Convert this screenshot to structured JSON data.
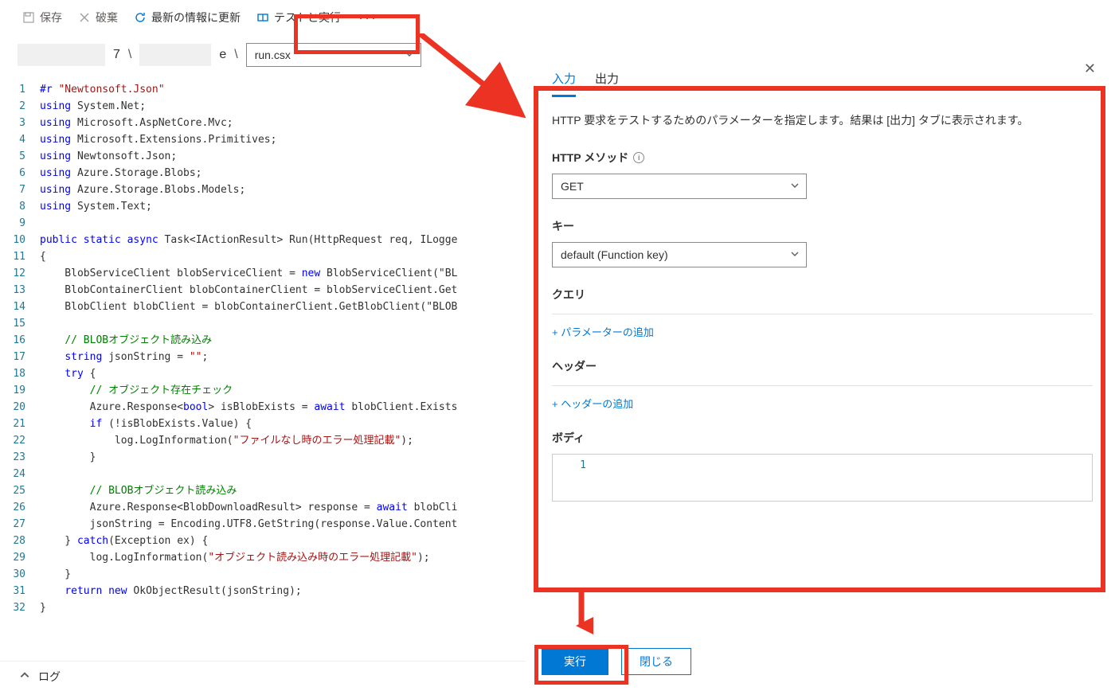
{
  "toolbar": {
    "save": "保存",
    "discard": "破棄",
    "refresh": "最新の情報に更新",
    "test_run": "テストと実行"
  },
  "breadcrumb": {
    "seg1_tail": "7",
    "seg2_tail": "e",
    "file": "run.csx"
  },
  "code": {
    "lines": [
      "#r \"Newtonsoft.Json\"",
      "using System.Net;",
      "using Microsoft.AspNetCore.Mvc;",
      "using Microsoft.Extensions.Primitives;",
      "using Newtonsoft.Json;",
      "using Azure.Storage.Blobs;",
      "using Azure.Storage.Blobs.Models;",
      "using System.Text;",
      "",
      "public static async Task<IActionResult> Run(HttpRequest req, ILogge",
      "{",
      "    BlobServiceClient blobServiceClient = new BlobServiceClient(\"BL",
      "    BlobContainerClient blobContainerClient = blobServiceClient.Get",
      "    BlobClient blobClient = blobContainerClient.GetBlobClient(\"BLOB",
      "",
      "    // BLOBオブジェクト読み込み",
      "    string jsonString = \"\";",
      "    try {",
      "        // オブジェクト存在チェック",
      "        Azure.Response<bool> isBlobExists = await blobClient.Exists",
      "        if (!isBlobExists.Value) {",
      "            log.LogInformation(\"ファイルなし時のエラー処理記載\");",
      "        }",
      "",
      "        // BLOBオブジェクト読み込み",
      "        Azure.Response<BlobDownloadResult> response = await blobCli",
      "        jsonString = Encoding.UTF8.GetString(response.Value.Content",
      "    } catch(Exception ex) {",
      "        log.LogInformation(\"オブジェクト読み込み時のエラー処理記載\");",
      "    }",
      "    return new OkObjectResult(jsonString);",
      "}"
    ]
  },
  "panel": {
    "tab_input": "入力",
    "tab_output": "出力",
    "desc": "HTTP 要求をテストするためのパラメーターを指定します。結果は [出力] タブに表示されます。",
    "http_method_label": "HTTP メソッド",
    "http_method_value": "GET",
    "key_label": "キー",
    "key_value": "default (Function key)",
    "query_label": "クエリ",
    "query_add": "+ パラメーターの追加",
    "header_label": "ヘッダー",
    "header_add": "+ ヘッダーの追加",
    "body_label": "ボディ",
    "body_line": "1",
    "run_btn": "実行",
    "close_btn": "閉じる"
  },
  "log": {
    "label": "ログ"
  }
}
